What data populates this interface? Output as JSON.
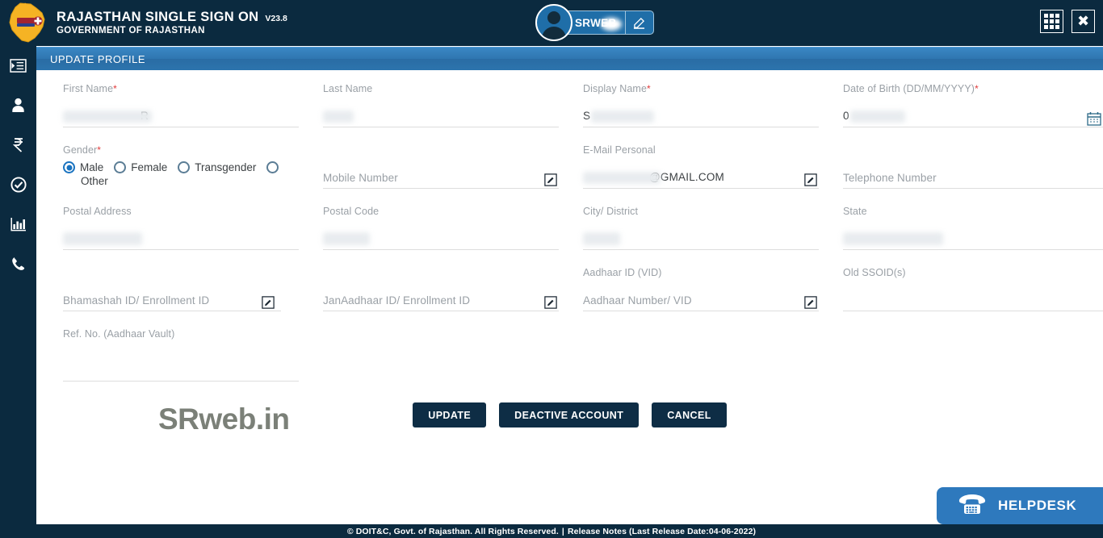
{
  "header": {
    "title": "RAJASTHAN SINGLE SIGN ON",
    "version": "V23.8",
    "subtitle": "GOVERNMENT OF RAJASTHAN",
    "user_name": "SRWEB",
    "logo_name": "rajasthan-state-emblem",
    "apps_icon": "grid-apps-icon",
    "close_icon": "close-icon",
    "edit_icon": "edit-icon",
    "bg_color": "#0b2a3f"
  },
  "sidebar": {
    "items": [
      {
        "icon": "menu-list-icon",
        "label": "Menu"
      },
      {
        "icon": "user-icon",
        "label": "User"
      },
      {
        "icon": "rupee-icon",
        "label": "Payments"
      },
      {
        "icon": "check-circle-icon",
        "label": "Verified"
      },
      {
        "icon": "bar-chart-icon",
        "label": "Reports"
      },
      {
        "icon": "phone-icon",
        "label": "Contact"
      }
    ]
  },
  "page": {
    "title": "UPDATE PROFILE",
    "titlebar_color": "#2f76b0"
  },
  "form": {
    "fields": [
      {
        "name": "first-name",
        "label": "First Name",
        "required": true,
        "value": "     R",
        "blurred": true,
        "blur_width": 110,
        "type": "text",
        "edit": false
      },
      {
        "name": "last-name",
        "label": "Last Name",
        "required": false,
        "value": "",
        "blurred": true,
        "blur_width": 38,
        "type": "text",
        "edit": false
      },
      {
        "name": "display-name",
        "label": "Display Name",
        "required": true,
        "value": "S",
        "blurred": true,
        "blur_width": 78,
        "type": "text",
        "edit": false
      },
      {
        "name": "date-of-birth",
        "label": "Date of Birth (DD/MM/YYYY)",
        "required": true,
        "value": "0",
        "blurred": true,
        "blur_width": 68,
        "type": "date",
        "edit": false,
        "calendar": true
      },
      {
        "name": "gender",
        "label": "Gender",
        "required": true,
        "type": "radio-group",
        "options": [
          {
            "label": "Male",
            "selected": true
          },
          {
            "label": "Female",
            "selected": false
          },
          {
            "label": "Transgender",
            "selected": false
          },
          {
            "label": "Other",
            "selected": false
          }
        ]
      },
      {
        "name": "mobile-number",
        "label": "",
        "required": false,
        "placeholder": "Mobile Number",
        "value": "",
        "blurred": false,
        "type": "text",
        "edit": true
      },
      {
        "name": "email-personal",
        "label": "E-Mail Personal",
        "required": false,
        "value": "@GMAIL.COM",
        "blurred": true,
        "blur_width": 96,
        "type": "text",
        "edit": true
      },
      {
        "name": "telephone-number",
        "label": "",
        "required": false,
        "placeholder": "Telephone Number",
        "value": "",
        "blurred": false,
        "type": "text",
        "edit": false
      },
      {
        "name": "postal-address",
        "label": "Postal Address",
        "required": false,
        "value": "",
        "blurred": true,
        "blur_width": 98,
        "type": "text",
        "edit": false
      },
      {
        "name": "postal-code",
        "label": "Postal Code",
        "required": false,
        "value": "",
        "blurred": true,
        "blur_width": 58,
        "type": "text",
        "edit": false
      },
      {
        "name": "city-district",
        "label": "City/ District",
        "required": false,
        "value": "",
        "blurred": true,
        "blur_width": 46,
        "type": "text",
        "edit": false
      },
      {
        "name": "state",
        "label": "State",
        "required": false,
        "value": "",
        "blurred": true,
        "blur_width": 124,
        "type": "text",
        "edit": false
      },
      {
        "name": "bhamashah-id",
        "label": "",
        "required": false,
        "placeholder": "Bhamashah ID/ Enrollment ID",
        "value": "",
        "blurred": false,
        "type": "text",
        "edit": true
      },
      {
        "name": "janaadhaar-id",
        "label": "",
        "required": false,
        "placeholder": "JanAadhaar ID/ Enrollment ID",
        "value": "",
        "blurred": false,
        "type": "text",
        "edit": true
      },
      {
        "name": "aadhaar-id-vid",
        "label": "Aadhaar ID (VID)",
        "required": false,
        "placeholder": "Aadhaar Number/ VID",
        "value": "",
        "blurred": false,
        "type": "text",
        "edit": true
      },
      {
        "name": "old-ssoid",
        "label": "Old SSOID(s)",
        "required": false,
        "value": "",
        "blurred": false,
        "type": "text",
        "edit": false
      },
      {
        "name": "ref-no-aadhaar-vault",
        "label": "Ref. No. (Aadhaar Vault)",
        "required": false,
        "value": "",
        "blurred": false,
        "type": "text",
        "edit": false
      }
    ]
  },
  "buttons": [
    {
      "name": "update-button",
      "label": "UPDATE"
    },
    {
      "name": "deactive-account-button",
      "label": "DEACTIVE ACCOUNT"
    },
    {
      "name": "cancel-button",
      "label": "CANCEL"
    }
  ],
  "watermark": {
    "text": "SRweb.in"
  },
  "helpdesk": {
    "label": "HELPDESK",
    "icon": "telephone-icon",
    "color": "#2e79bd"
  },
  "footer": {
    "copyright": "© DOIT&C, Govt. of Rajasthan. All Rights Reserved.",
    "separator": "|",
    "release": "Release Notes (Last Release Date:04-06-2022)"
  }
}
